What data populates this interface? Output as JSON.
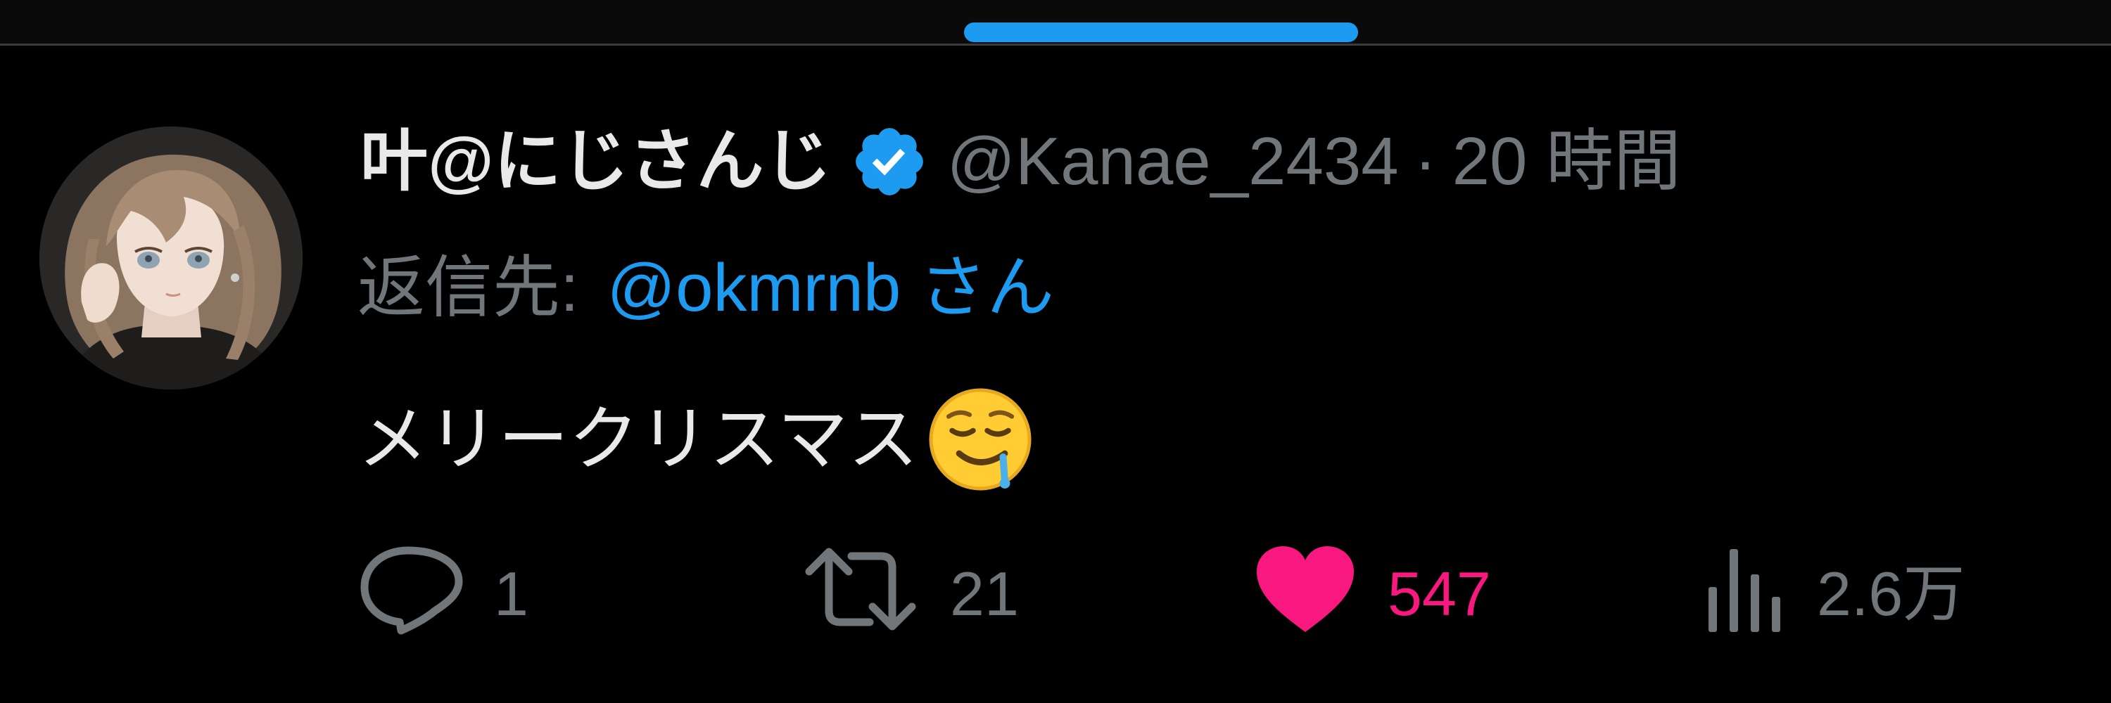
{
  "tweet": {
    "display_name": "叶@にじさんじ",
    "handle": "@Kanae_2434",
    "separator": "·",
    "timestamp": "20 時間",
    "verified": true,
    "reply_to": {
      "prefix": "返信先:",
      "handle": "@okmrnb",
      "suffix": "さん"
    },
    "text": "メリークリスマス",
    "emoji": "drooling-face"
  },
  "actions": {
    "replies": "1",
    "retweets": "21",
    "likes": "547",
    "views": "2.6万"
  },
  "colors": {
    "background": "#000000",
    "accent": "#1d9bf0",
    "like": "#f91880",
    "muted": "#71767b",
    "text": "#e7e9ea"
  },
  "icons": {
    "avatar": "avatar",
    "verified": "verified-badge-icon",
    "reply": "speech-bubble-icon",
    "retweet": "retweet-arrows-icon",
    "like": "heart-icon",
    "views": "bar-chart-icon"
  }
}
